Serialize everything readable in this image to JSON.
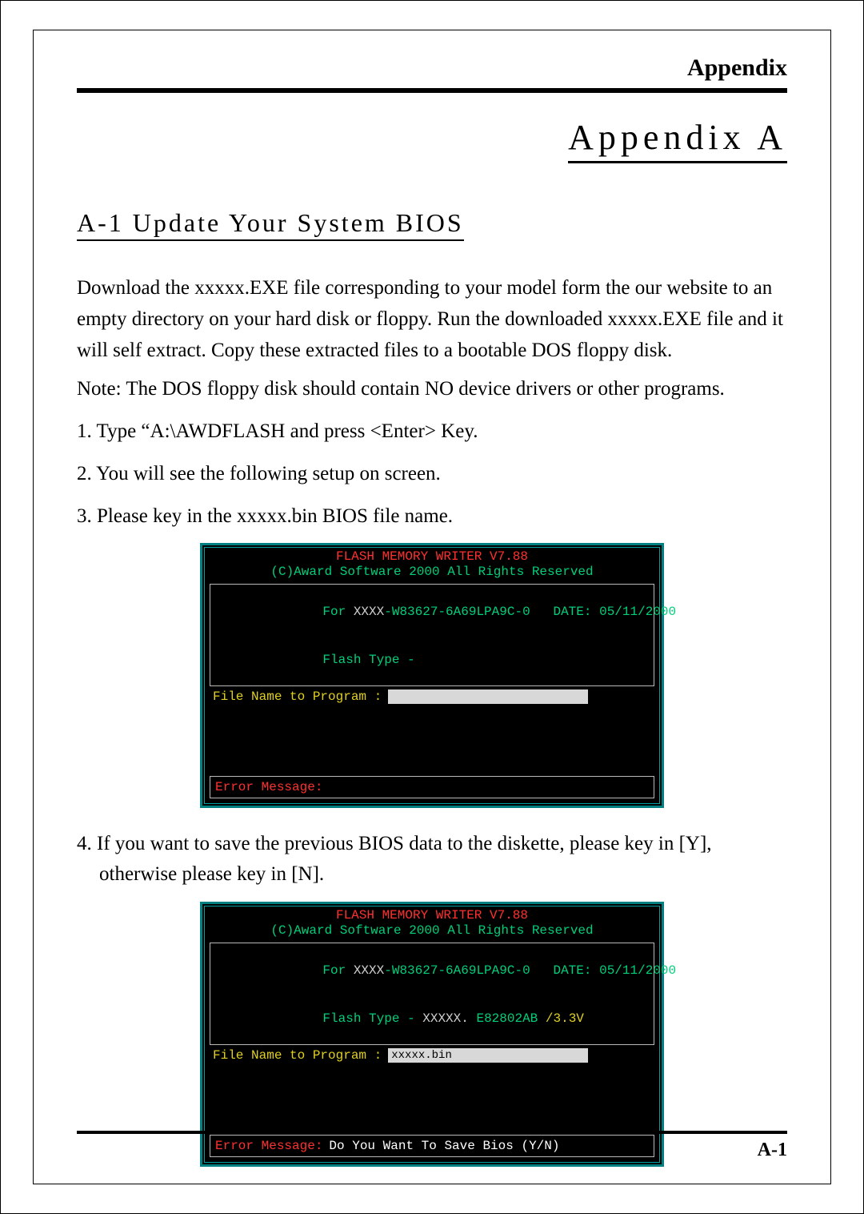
{
  "header": {
    "label": "Appendix"
  },
  "title": "Appendix A",
  "section_title": "A-1  Update Your System BIOS",
  "paragraph1": "Download the xxxxx.EXE file corresponding to your model form the our website to an empty directory on your hard disk or floppy.  Run the downloaded xxxxx.EXE file  and it will self extract.  Copy these extracted files to a bootable DOS floppy disk.",
  "note": "Note: The DOS floppy disk should contain NO device drivers or other programs.",
  "step1": "1. Type “A:\\AWDFLASH and press <Enter> Key.",
  "step2": "2. You will see the following  setup on screen.",
  "step3": "3. Please key in the xxxxx.bin BIOS file name.",
  "step4": "4. If you want to save the previous BIOS data to the diskette, please key in [Y], otherwise please key in [N].",
  "terminal": {
    "title_red": "FLASH  MEMORY  WRITER V7.88",
    "title_green": "(C)Award Software 2000 All Rights Reserved",
    "info_for_label": "For ",
    "info_xxxx": "XXXX",
    "info_ident": "-W83627-6A69LPA9C-0",
    "info_date": "   DATE: 05/11/2000",
    "flash_type_label": "Flash Type -",
    "flash_type_value": " XXXXX.",
    "flash_type_detail": " E82802AB",
    "flash_type_voltage": " /3.3V",
    "file_prompt": "File Name to Program :",
    "input_blank": "",
    "input_value": "xxxxx.bin",
    "error_label": "Error Message:",
    "error_prompt": "Do You Want To Save Bios (Y/N)"
  },
  "page_number": "A-1"
}
